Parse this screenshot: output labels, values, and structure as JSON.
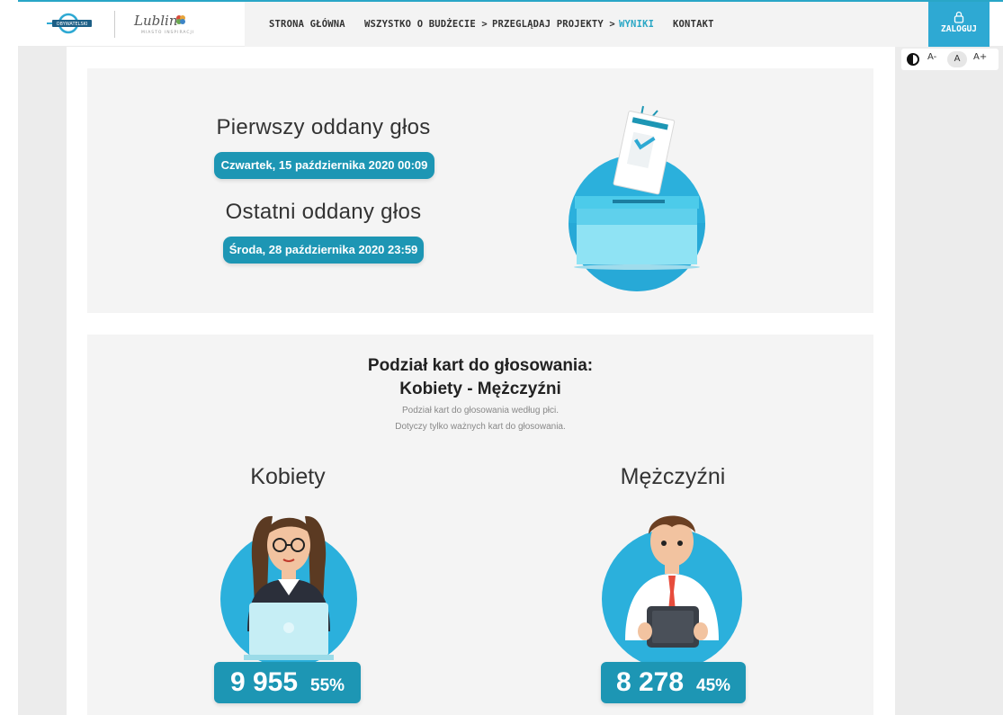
{
  "header": {
    "logo_budget_text": "BUDŻET OBYWATELSKI",
    "logo_city_text": "Lublin",
    "logo_city_tagline": "MIASTO INSPIRACJI",
    "nav": [
      {
        "label": "STRONA GŁÓWNA",
        "active": false
      },
      {
        "label": "WSZYSTKO O BUDŻECIE >",
        "active": false
      },
      {
        "label": "PRZEGLĄDAJ PROJEKTY >",
        "active": false
      },
      {
        "label": "WYNIKI",
        "active": true
      },
      {
        "label": "KONTAKT",
        "active": false
      }
    ],
    "login_label": "ZALOGUJ"
  },
  "accessibility": {
    "contrast_icon": "contrast-icon",
    "font_smaller": "A-",
    "font_normal": "A",
    "font_larger": "A+"
  },
  "votes_timing": {
    "first_label": "Pierwszy oddany głos",
    "first_date": "Czwartek, 15 października 2020 00:09",
    "last_label": "Ostatni oddany głos",
    "last_date": "Środa, 28 października 2020 23:59",
    "illustration_icon": "ballot-box-icon"
  },
  "gender_split": {
    "title_line1": "Podział kart do głosowania:",
    "title_line2": "Kobiety - Mężczyźni",
    "subtitle_line1": "Podział kart do głosowania według płci.",
    "subtitle_line2": "Dotyczy tylko ważnych kart do głosowania.",
    "women": {
      "label": "Kobiety",
      "count": "9 955",
      "percent": "55%",
      "icon": "woman-laptop-icon"
    },
    "men": {
      "label": "Mężczyźni",
      "count": "8 278",
      "percent": "45%",
      "icon": "man-tablet-icon"
    }
  },
  "colors": {
    "accent": "#2ea9d3",
    "pill": "#1d96b4",
    "panel": "#f4f4f4"
  }
}
